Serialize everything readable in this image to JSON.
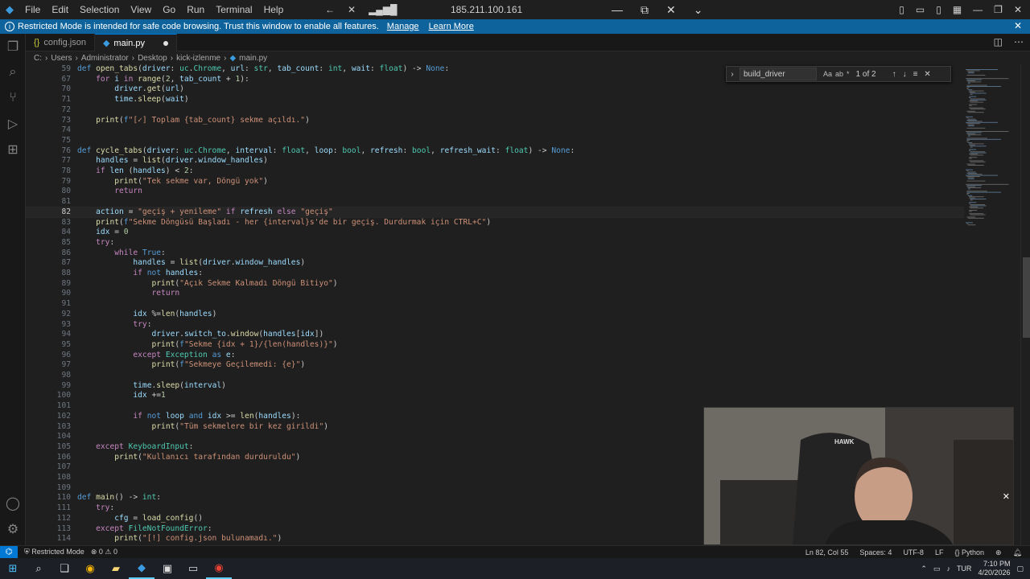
{
  "titlebar": {
    "menu": [
      "File",
      "Edit",
      "Selection",
      "View",
      "Go",
      "Run",
      "Terminal",
      "Help"
    ],
    "host": "185.211.100.161"
  },
  "banner": {
    "message": "Restricted Mode is intended for safe code browsing. Trust this window to enable all features.",
    "manage": "Manage",
    "learn_more": "Learn More"
  },
  "tabs": [
    {
      "label": "config.json",
      "icon": "json-braces-icon"
    },
    {
      "label": "main.py",
      "icon": "python-icon"
    }
  ],
  "breadcrumb": [
    "C:",
    "Users",
    "Administrator",
    "Desktop",
    "kick-izlenme",
    "main.py"
  ],
  "find": {
    "query": "build_driver",
    "option_labels": [
      "Aa",
      "ab",
      "*"
    ],
    "count": "1 of 2"
  },
  "editor": {
    "current_line": 82,
    "lines": [
      {
        "n": "59",
        "text": "def open_tabs(driver: uc.Chrome, url: str, tab_count: int, wait: float) -> None:"
      },
      {
        "n": "67",
        "text": "    for i in range(2, tab_count + 1):"
      },
      {
        "n": "70",
        "text": "        driver.get(url)"
      },
      {
        "n": "71",
        "text": "        time.sleep(wait)"
      },
      {
        "n": "72",
        "text": ""
      },
      {
        "n": "73",
        "text": "    print(f\"[✓] Toplam {tab_count} sekme açıldı.\")"
      },
      {
        "n": "74",
        "text": ""
      },
      {
        "n": "75",
        "text": ""
      },
      {
        "n": "76",
        "text": "def cycle_tabs(driver: uc.Chrome, interval: float, loop: bool, refresh: bool, refresh_wait: float) -> None:"
      },
      {
        "n": "77",
        "text": "    handles = list(driver.window_handles)"
      },
      {
        "n": "78",
        "text": "    if len (handles) < 2:"
      },
      {
        "n": "79",
        "text": "        print(\"Tek sekme var, Döngü yok\")"
      },
      {
        "n": "80",
        "text": "        return"
      },
      {
        "n": "81",
        "text": ""
      },
      {
        "n": "82",
        "text": "    action = \"geçiş + yenileme\" if refresh else \"geçiş\""
      },
      {
        "n": "83",
        "text": "    print(f\"Sekme Döngüsü Başladı - her {interval}s'de bir geçiş. Durdurmak için CTRL+C\")"
      },
      {
        "n": "84",
        "text": "    idx = 0"
      },
      {
        "n": "85",
        "text": "    try:"
      },
      {
        "n": "86",
        "text": "        while True:"
      },
      {
        "n": "87",
        "text": "            handles = list(driver.window_handles)"
      },
      {
        "n": "88",
        "text": "            if not handles:"
      },
      {
        "n": "89",
        "text": "                print(\"Açık Sekme Kalmadı Döngü Bitiyo\")"
      },
      {
        "n": "90",
        "text": "                return"
      },
      {
        "n": "91",
        "text": ""
      },
      {
        "n": "92",
        "text": "            idx %=len(handles)"
      },
      {
        "n": "93",
        "text": "            try:"
      },
      {
        "n": "94",
        "text": "                driver.switch_to.window(handles[idx])"
      },
      {
        "n": "95",
        "text": "                print(f\"Sekme {idx + 1}/{len(handles)}\")"
      },
      {
        "n": "96",
        "text": "            except Exception as e:"
      },
      {
        "n": "97",
        "text": "                print(f\"Sekmeye Geçilemedi: {e}\")"
      },
      {
        "n": "98",
        "text": ""
      },
      {
        "n": "99",
        "text": "            time.sleep(interval)"
      },
      {
        "n": "100",
        "text": "            idx +=1"
      },
      {
        "n": "101",
        "text": ""
      },
      {
        "n": "102",
        "text": "            if not loop and idx >= len(handles):"
      },
      {
        "n": "103",
        "text": "                print(\"Tüm sekmelere bir kez girildi\")"
      },
      {
        "n": "104",
        "text": ""
      },
      {
        "n": "105",
        "text": "    except KeyboardInput:"
      },
      {
        "n": "106",
        "text": "        print(\"Kullanıcı tarafından durduruldu\")"
      },
      {
        "n": "107",
        "text": ""
      },
      {
        "n": "108",
        "text": ""
      },
      {
        "n": "109",
        "text": ""
      },
      {
        "n": "110",
        "text": "def main() -> int:"
      },
      {
        "n": "111",
        "text": "    try:"
      },
      {
        "n": "112",
        "text": "        cfg = load_config()"
      },
      {
        "n": "113",
        "text": "    except FileNotFoundError:"
      },
      {
        "n": "114",
        "text": "        print(\"[!] config.json bulunamadı.\")"
      }
    ]
  },
  "status": {
    "restricted": "Restricted Mode",
    "problems": "0",
    "warnings": "0",
    "position": "Ln 82, Col 55",
    "spaces": "Spaces: 4",
    "encoding": "UTF-8",
    "eol": "LF",
    "language": "Python"
  },
  "taskbar": {
    "lang": "TUR",
    "time": "7:10 PM",
    "date": "4/20/2026"
  },
  "webcam": {
    "brand": "HAWK"
  },
  "colors": {
    "keyword": "#569cd6",
    "control": "#c586c0",
    "function": "#dcdcaa",
    "string": "#ce9178",
    "number": "#b5cea8",
    "type": "#4ec9b0",
    "variable": "#9cdcfe",
    "accent": "#0078d4"
  }
}
